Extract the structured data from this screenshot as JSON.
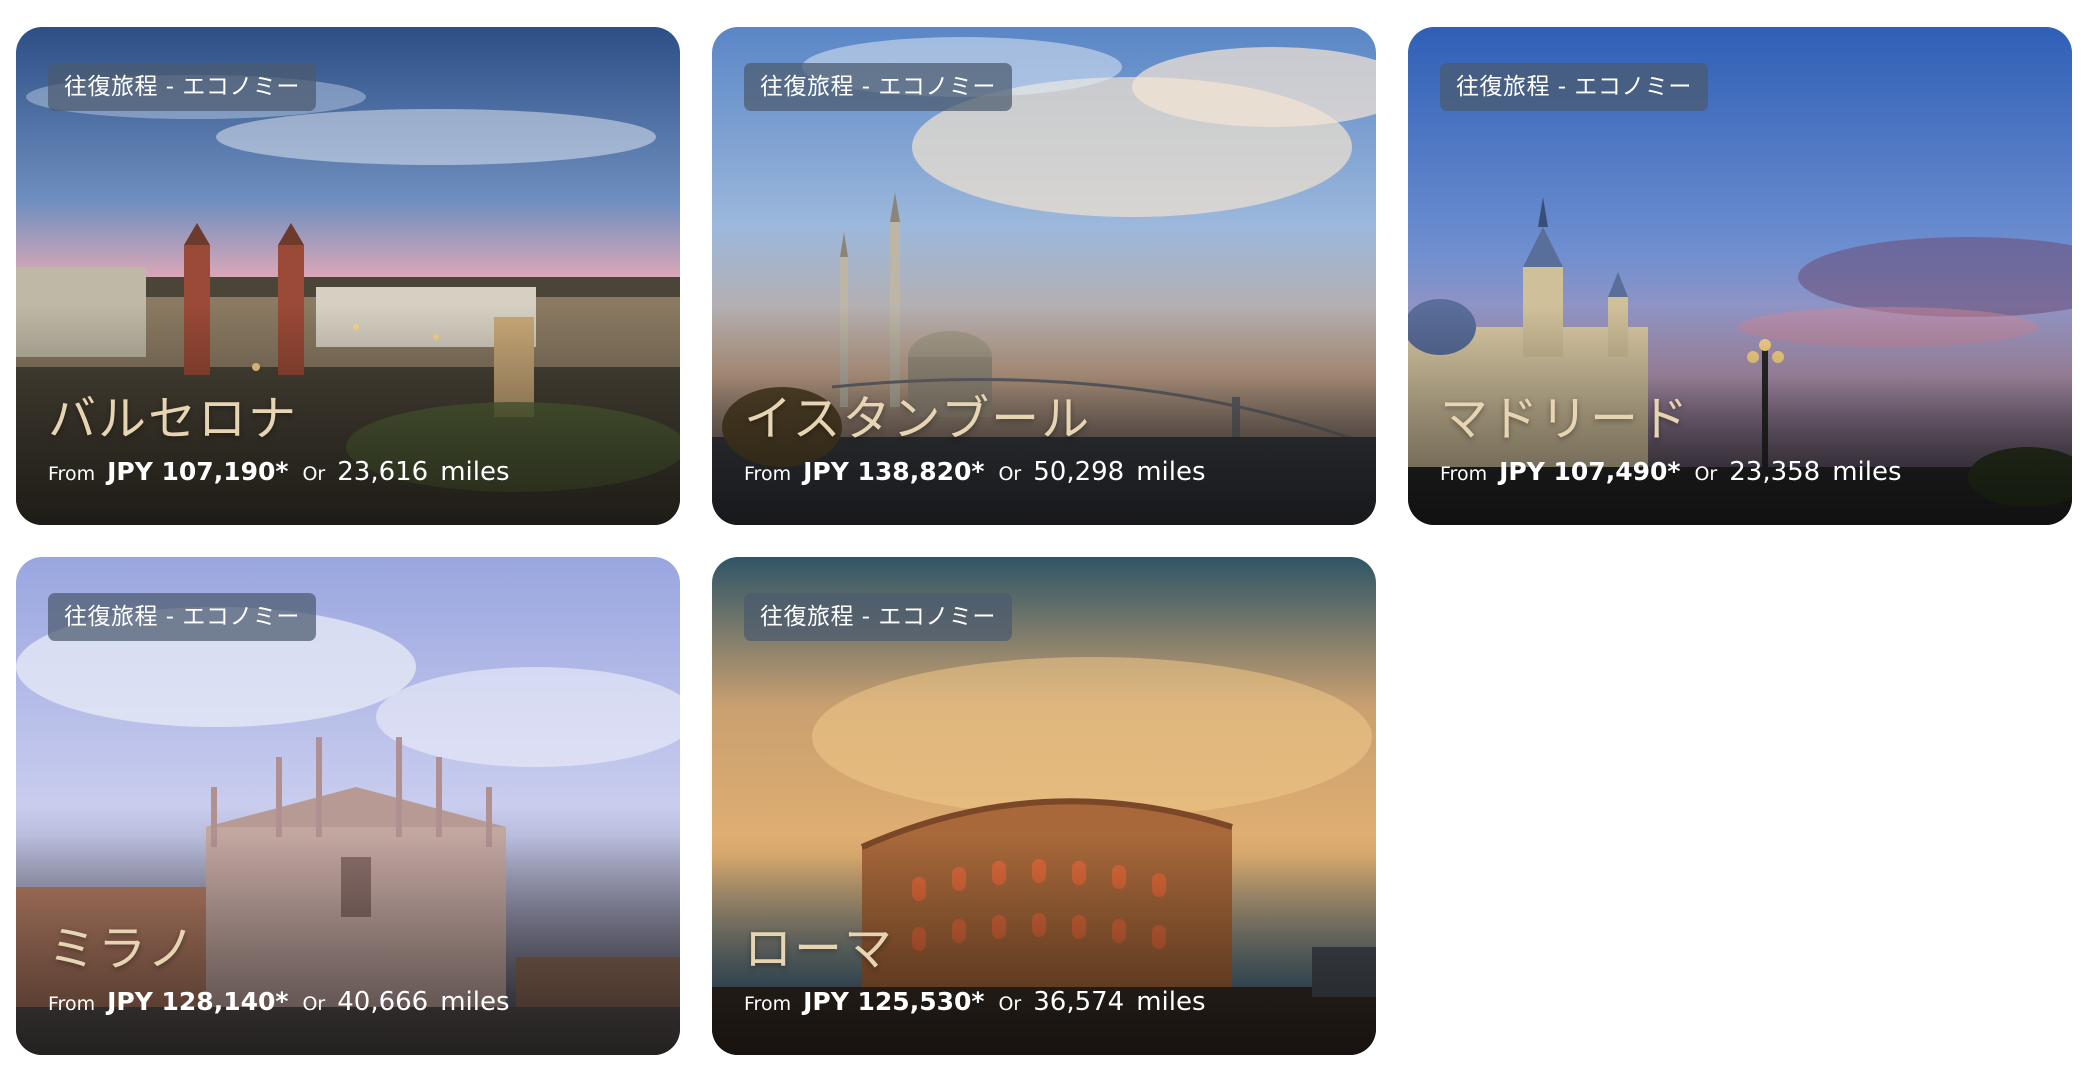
{
  "cards": [
    {
      "badge": "往復旅程 - エコノミー",
      "city": "バルセロナ",
      "from_label": "From",
      "price": "JPY 107,190*",
      "or_label": "Or",
      "miles": "23,616",
      "miles_unit": "miles"
    },
    {
      "badge": "往復旅程 - エコノミー",
      "city": "イスタンブール",
      "from_label": "From",
      "price": "JPY 138,820*",
      "or_label": "Or",
      "miles": "50,298",
      "miles_unit": "miles"
    },
    {
      "badge": "往復旅程 - エコノミー",
      "city": "マドリード",
      "from_label": "From",
      "price": "JPY 107,490*",
      "or_label": "Or",
      "miles": "23,358",
      "miles_unit": "miles"
    },
    {
      "badge": "往復旅程 - エコノミー",
      "city": "ミラノ",
      "from_label": "From",
      "price": "JPY 128,140*",
      "or_label": "Or",
      "miles": "40,666",
      "miles_unit": "miles"
    },
    {
      "badge": "往復旅程 - エコノミー",
      "city": "ローマ",
      "from_label": "From",
      "price": "JPY 125,530*",
      "or_label": "Or",
      "miles": "36,574",
      "miles_unit": "miles"
    }
  ]
}
